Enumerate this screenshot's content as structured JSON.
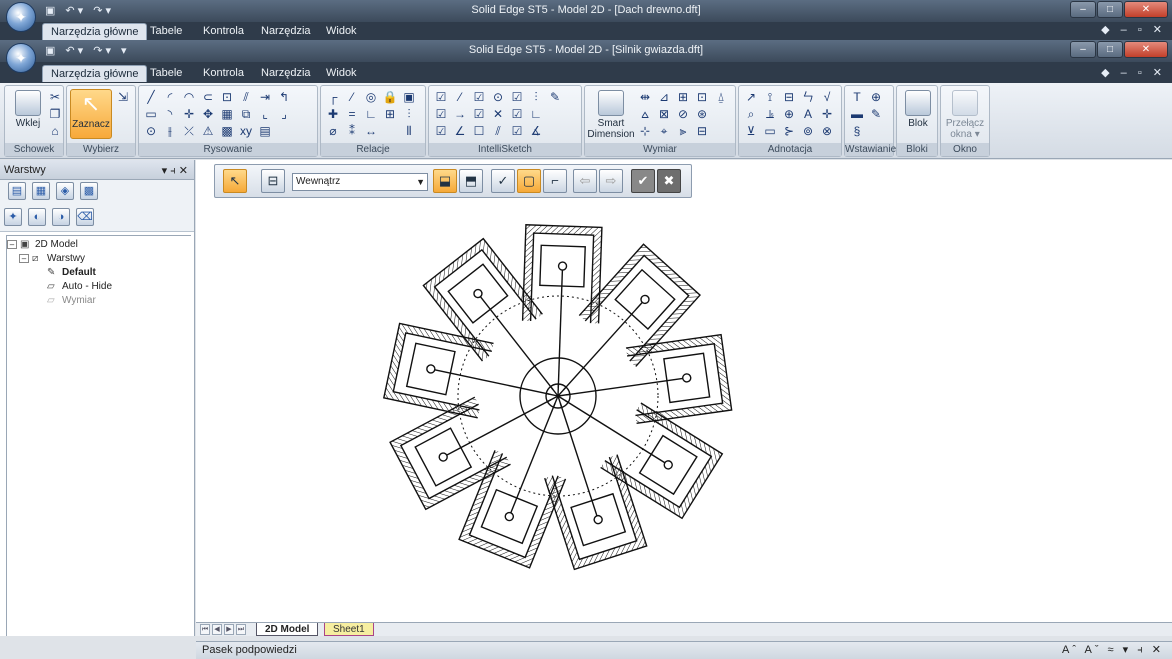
{
  "window_back": {
    "title": "Solid Edge ST5 - Model 2D - [Dach drewno.dft]"
  },
  "window_front": {
    "title": "Solid Edge ST5 - Model 2D - [Silnik gwiazda.dft]"
  },
  "qat": {
    "undo": "↶ ▾",
    "redo": "↷ ▾",
    "more": "▾"
  },
  "tabs": [
    "Narzędzia główne",
    "Tabele",
    "Kontrola",
    "Narzędzia",
    "Widok"
  ],
  "ribbon": {
    "groups": {
      "schowek": "Schowek",
      "wybierz": "Wybierz",
      "rysowanie": "Rysowanie",
      "relacje": "Relacje",
      "intellisketch": "IntelliSketch",
      "wymiar": "Wymiar",
      "adnotacja": "Adnotacja",
      "wstawianie": "Wstawianie",
      "bloki": "Bloki",
      "okno": "Okno"
    },
    "buttons": {
      "wklej": "Wklej",
      "zaznacz": "Zaznacz",
      "smart_dimension_1": "Smart",
      "smart_dimension_2": "Dimension",
      "blok": "Blok",
      "przelacz_1": "Przełącz",
      "przelacz_2": "okna ▾"
    }
  },
  "left_panel": {
    "title": "Warstwy",
    "controls": "▾ ⫞ ✕",
    "tree": {
      "root": "2D Model",
      "warstwy": "Warstwy",
      "default": "Default",
      "autohide": "Auto - Hide",
      "wymiar": "Wymiar"
    }
  },
  "toolbar": {
    "combo_value": "Wewnątrz"
  },
  "sheet_tabs": {
    "model": "2D Model",
    "sheet1": "Sheet1"
  },
  "status": {
    "text": "Pasek podpowiedzi",
    "controls": "Aˆ Aˇ ≈ ▾ ⫞ ✕"
  },
  "colors": {
    "accent": "#f6a938",
    "title_bar": "#3c4a5b"
  }
}
